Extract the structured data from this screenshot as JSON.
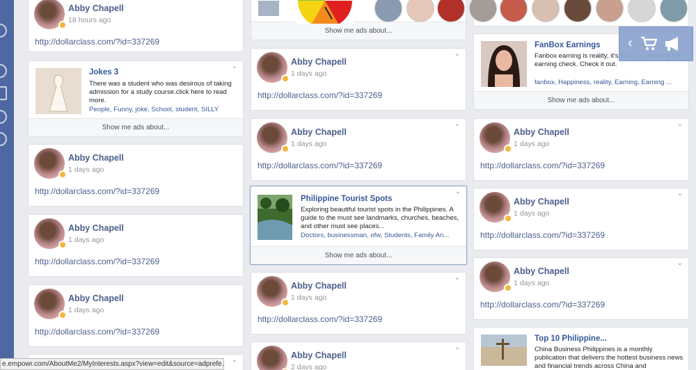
{
  "posts": {
    "name": "Abby Chapell",
    "link": "http://dollarclass.com/?id=337269",
    "time_18h": "18 hours ago",
    "time_1d": "1 days ago",
    "time_2d": "2 days ago"
  },
  "ads": {
    "show_me": "Show me ads about...",
    "jokes": {
      "title": "Jokes 3",
      "desc": "There was a student who was desirous of taking admission for a study course.click here to read more.",
      "tags": "People, Funny, joke, School, student, SILLY"
    },
    "fanbox": {
      "title": "FanBox Earnings",
      "desc": "Fanbox earning is reality, it's true I am posting my earning check. Check it out.",
      "tags": "fanbox, Happiness, reality, Earning, Earning ..."
    },
    "tourist": {
      "title": "Philippine Tourist Spots",
      "desc": "Exploring beautiful tourist spots in the Philippines. A guide to the must see landmarks, churches, beaches, and other must see places...",
      "tags": "Doctors, businessman, ofw, Students, Family An..."
    },
    "top10": {
      "title": "Top 10 Philippine...",
      "desc": "China Business Philippines is a monthly publication that delivers the hottest business news and financial trends across China and"
    }
  },
  "cart": {
    "back_icon": "chevron-left-icon",
    "cart_icon": "shopping-cart-icon",
    "megaphone_icon": "megaphone-icon"
  },
  "status_url": "e.empowr.com/AboutMe2/MyInterests.aspx?view=edit&source=adprefe..."
}
